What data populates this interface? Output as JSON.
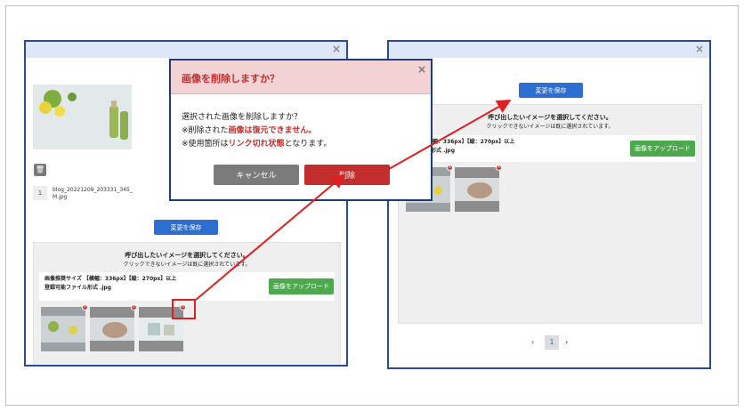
{
  "left_panel": {
    "file_name": "blog_20221209_203331_345_M.jpg",
    "file_index": "1",
    "save_button": "変更を保存",
    "area_title": "呼び出したいイメージを選択してください。",
    "area_sub": "クリックできないイメージは既に選択されています。",
    "info_line1": "画像推奨サイズ 【横幅：336px】【縦：270px】以上",
    "info_line2": "登録可能ファイル形式 .jpg",
    "upload_button": "画像をアップロード"
  },
  "modal": {
    "title": "画像を削除しますか？",
    "line1": "選択された画像を削除しますか？",
    "line2_prefix": "※削除された",
    "line2_red": "画像は復元できません。",
    "line3_prefix": "※使用箇所は",
    "line3_red": "リンク切れ状態",
    "line3_suffix": "となります。",
    "cancel_button": "キャンセル",
    "delete_button": "削除"
  },
  "right_panel": {
    "save_button": "変更を保存",
    "area_title": "呼び出したいイメージを選択してください。",
    "area_sub": "クリックできないイメージは既に選択されています。",
    "info_line1": "イズ 【横幅：336px】【縦：270px】以上",
    "info_line2": "ファイル形式 .jpg",
    "upload_button": "画像をアップロード",
    "pager_prev": "‹",
    "pager_page": "1",
    "pager_next": "›"
  },
  "icons": {
    "close": "close-icon",
    "trash": "trash-icon",
    "remove": "remove-icon"
  },
  "colors": {
    "accent_blue": "#2d6fd0",
    "green": "#4ea94e",
    "delete_red": "#c42d2d",
    "arrow_red": "#e02020"
  }
}
